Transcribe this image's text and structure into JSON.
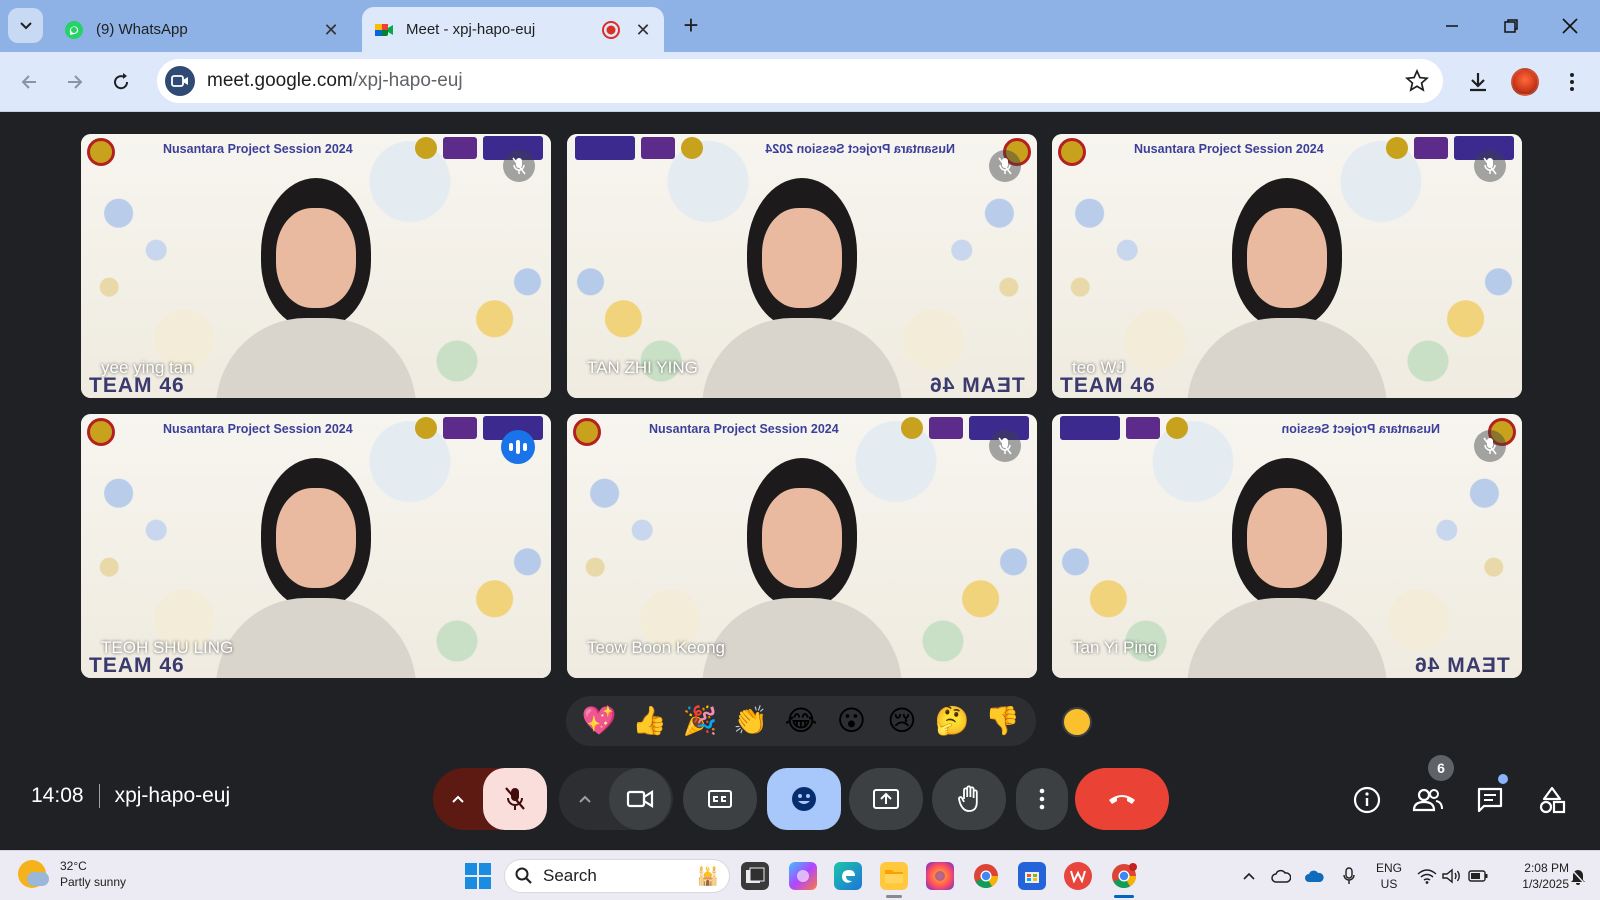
{
  "browser": {
    "tabs": [
      {
        "title": "(9) WhatsApp",
        "active": false
      },
      {
        "title": "Meet - xpj-hapo-euj",
        "active": true
      }
    ],
    "url_host": "meet.google.com",
    "url_path": "/xpj-hapo-euj"
  },
  "meet": {
    "tiles": [
      {
        "name": "yee ying tan",
        "banner": "Nusantara Project Session 2024",
        "team": "TEAM 46",
        "mirrored": false,
        "speaking": false
      },
      {
        "name": "TAN ZHI YING",
        "banner": "Nusantara Project Session 2024",
        "team": "TEAM 46",
        "mirrored": true,
        "speaking": false
      },
      {
        "name": "teo WJ",
        "banner": "Nusantara Project Session 2024",
        "team": "TEAM 46",
        "mirrored": false,
        "speaking": false
      },
      {
        "name": "TEOH SHU LING",
        "banner": "Nusantara Project Session 2024",
        "team": "TEAM 46",
        "mirrored": false,
        "speaking": true
      },
      {
        "name": "Teow Boon Keong",
        "banner": "Nusantara Project Session 2024",
        "team": "",
        "mirrored": false,
        "speaking": false
      },
      {
        "name": "Tan Yi Ping",
        "banner": "Nusantara Project Session",
        "team": "TEAM 46",
        "mirrored": true,
        "speaking": false
      }
    ],
    "reactions": [
      "💖",
      "👍",
      "🎉",
      "👏",
      "😂",
      "😮",
      "😢",
      "🤔",
      "👎"
    ],
    "time": "14:08",
    "meeting_code": "xpj-hapo-euj",
    "participant_count": "6",
    "colors": {
      "accent": "#8ab4f8",
      "leave": "#ea4335",
      "mic_off_bg": "#f9dedc"
    }
  },
  "taskbar": {
    "weather_temp": "32°C",
    "weather_desc": "Partly sunny",
    "search_label": "Search",
    "lang_line1": "ENG",
    "lang_line2": "US",
    "clock_time": "2:08 PM",
    "clock_date": "1/3/2025"
  }
}
